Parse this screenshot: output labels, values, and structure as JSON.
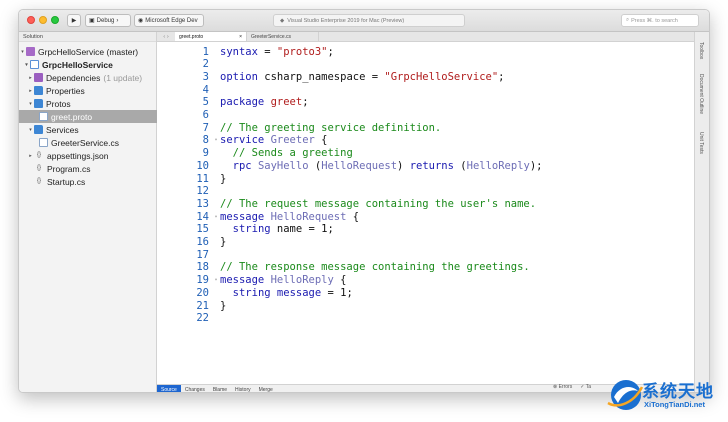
{
  "titlebar": {
    "config": "Debug",
    "device": "Microsoft Edge Dev",
    "status": "Visual Studio Enterprise 2019 for Mac (Preview)",
    "search_placeholder": "Press ⌘. to search"
  },
  "sidebar": {
    "header": "Solution",
    "items": [
      {
        "label": "GrpcHelloService (master)",
        "icon": "solution-icon",
        "arrow": "▾",
        "extra": ""
      },
      {
        "label": "GrpcHelloService",
        "icon": "project-icon",
        "arrow": "▾",
        "extra": ""
      },
      {
        "label": "Dependencies",
        "icon": "dependencies-icon",
        "arrow": "▸",
        "extra": "(1 update)"
      },
      {
        "label": "Properties",
        "icon": "folder-icon",
        "arrow": "▸",
        "extra": ""
      },
      {
        "label": "Protos",
        "icon": "folder-icon",
        "arrow": "▾",
        "extra": ""
      },
      {
        "label": "greet.proto",
        "icon": "file-icon",
        "arrow": "",
        "extra": ""
      },
      {
        "label": "Services",
        "icon": "folder-icon",
        "arrow": "▾",
        "extra": ""
      },
      {
        "label": "GreeterService.cs",
        "icon": "file-icon",
        "arrow": "",
        "extra": ""
      },
      {
        "label": "appsettings.json",
        "icon": "json-icon",
        "arrow": "▸",
        "extra": ""
      },
      {
        "label": "Program.cs",
        "icon": "file-icon",
        "arrow": "",
        "extra": ""
      },
      {
        "label": "Startup.cs",
        "icon": "file-icon",
        "arrow": "",
        "extra": ""
      }
    ]
  },
  "tabs": [
    {
      "label": "greet.proto",
      "active": true
    },
    {
      "label": "GreeterService.cs",
      "active": false
    }
  ],
  "code": {
    "lines": [
      {
        "n": "1",
        "text": "syntax = \"proto3\";"
      },
      {
        "n": "2",
        "text": ""
      },
      {
        "n": "3",
        "text": "option csharp_namespace = \"GrpcHelloService\";"
      },
      {
        "n": "4",
        "text": ""
      },
      {
        "n": "5",
        "text": "package greet;"
      },
      {
        "n": "6",
        "text": ""
      },
      {
        "n": "7",
        "text": "// The greeting service definition."
      },
      {
        "n": "8",
        "text": "service Greeter {"
      },
      {
        "n": "9",
        "text": "  // Sends a greeting"
      },
      {
        "n": "10",
        "text": "  rpc SayHello (HelloRequest) returns (HelloReply);"
      },
      {
        "n": "11",
        "text": "}"
      },
      {
        "n": "12",
        "text": ""
      },
      {
        "n": "13",
        "text": "// The request message containing the user's name."
      },
      {
        "n": "14",
        "text": "message HelloRequest {"
      },
      {
        "n": "15",
        "text": "  string name = 1;"
      },
      {
        "n": "16",
        "text": "}"
      },
      {
        "n": "17",
        "text": ""
      },
      {
        "n": "18",
        "text": "// The response message containing the greetings."
      },
      {
        "n": "19",
        "text": "message HelloReply {"
      },
      {
        "n": "20",
        "text": "  string message = 1;"
      },
      {
        "n": "21",
        "text": "}"
      },
      {
        "n": "22",
        "text": ""
      }
    ]
  },
  "bottom_tabs": [
    "Source",
    "Changes",
    "Blame",
    "History",
    "Merge"
  ],
  "right_dock": [
    "Toolbox",
    "Document Outline",
    "Unit Tests"
  ],
  "statusbar": {
    "errors": "Errors",
    "tasks": "Ta"
  },
  "watermark": {
    "title": "系统天地",
    "url": "XiTongTianDi.net"
  },
  "colors": {
    "keyword": "#1a1ab0",
    "string": "#b01c1c",
    "comment": "#1b8a1b",
    "type": "#6d6db5",
    "line_number": "#1f5fb5",
    "selection": "#a9a9a9",
    "accent": "#1e66d0"
  }
}
